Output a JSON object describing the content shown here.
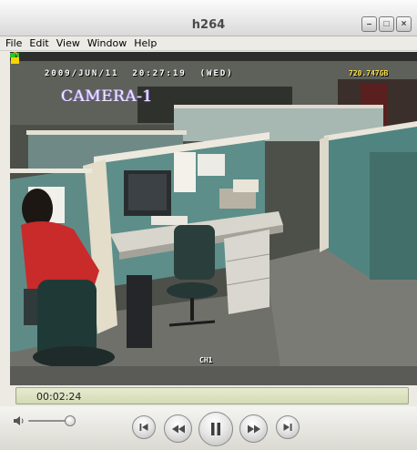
{
  "window": {
    "title": "h264"
  },
  "title_controls": {
    "minimize_glyph": "–",
    "maximize_glyph": "□",
    "close_glyph": "×"
  },
  "menu": {
    "items": [
      "File",
      "Edit",
      "View",
      "Window",
      "Help"
    ]
  },
  "video": {
    "osd_datetime": "2009/JUN/11  20:27:19  (WED)",
    "osd_disk_label": "720.747GB",
    "osd_camera_label": "CAMERA-1",
    "osd_channel": "CH1",
    "lock_icon": "lock-icon",
    "record_icon": "record-indicator-icon",
    "colors": {
      "osd_text": "#ffffff",
      "osd_disk": "#ffe24a",
      "lock": "#f5d400",
      "record": "#2fbf2f"
    }
  },
  "playback": {
    "current_time": "00:02:24",
    "volume_level_percent": 85,
    "buttons": [
      {
        "name": "skip-to-start-button",
        "icon": "skip-start-icon"
      },
      {
        "name": "rewind-button",
        "icon": "rewind-icon"
      },
      {
        "name": "pause-button",
        "icon": "pause-icon"
      },
      {
        "name": "fast-forward-button",
        "icon": "fast-forward-icon"
      },
      {
        "name": "skip-to-end-button",
        "icon": "skip-end-icon"
      }
    ]
  }
}
